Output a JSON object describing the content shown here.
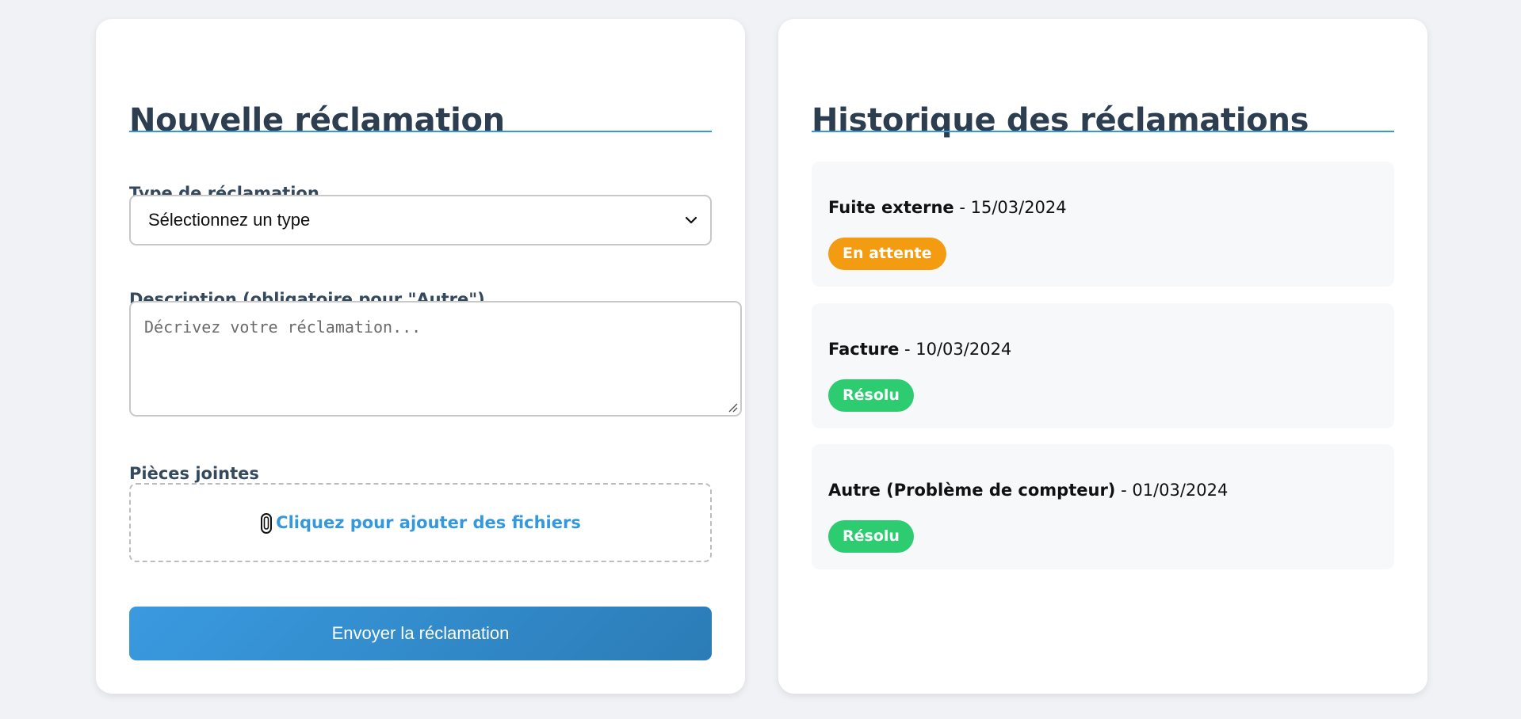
{
  "form": {
    "title": "Nouvelle réclamation",
    "type_label": "Type de réclamation",
    "type_select_value": "Sélectionnez un type",
    "description_label": "Description (obligatoire pour \"Autre\")",
    "description_placeholder": "Décrivez votre réclamation...",
    "attachments_label": "Pièces jointes",
    "attachments_prompt": "Cliquez pour ajouter des fichiers",
    "submit_label": "Envoyer la réclamation"
  },
  "history": {
    "title": "Historique des réclamations",
    "items": [
      {
        "type": "Fuite externe",
        "date": " - 15/03/2024",
        "status": "En attente",
        "status_color": "#f39c12"
      },
      {
        "type": "Facture",
        "date": " - 10/03/2024",
        "status": "Résolu",
        "status_color": "#2ecc71"
      },
      {
        "type": "Autre (Problème de compteur)",
        "date": " - 01/03/2024",
        "status": "Résolu",
        "status_color": "#2ecc71"
      }
    ]
  },
  "icons": {
    "select": "chevron-down-icon",
    "attachment": "paperclip-icon",
    "resize": "resize-handle-icon"
  },
  "colors": {
    "accent": "#3498db",
    "pending": "#f39c12",
    "resolved": "#2ecc71",
    "heading": "#2c3e50"
  }
}
